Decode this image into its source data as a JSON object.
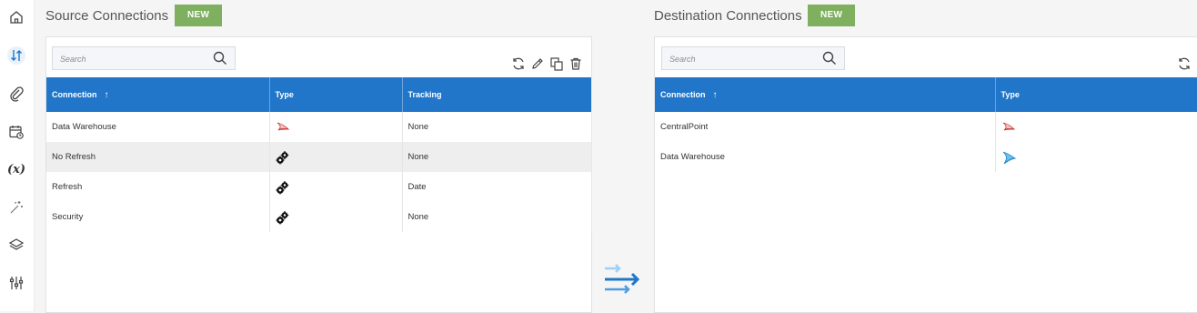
{
  "sidebar": {
    "items": [
      {
        "icon": "home-icon"
      },
      {
        "icon": "transfer-icon",
        "selected": true
      },
      {
        "icon": "paperclip-icon"
      },
      {
        "icon": "calendar-clock-icon"
      },
      {
        "icon": "variable-icon",
        "text": "(x)"
      },
      {
        "icon": "magic-wand-icon"
      },
      {
        "icon": "layers-icon"
      },
      {
        "icon": "sliders-icon"
      }
    ]
  },
  "source": {
    "title": "Source Connections",
    "new_label": "NEW",
    "search_placeholder": "Search",
    "toolbar": [
      "refresh-icon",
      "edit-icon",
      "copy-icon",
      "delete-icon"
    ],
    "columns": [
      "Connection",
      "Type",
      "Tracking"
    ],
    "rows": [
      {
        "connection": "Data Warehouse",
        "type": "sql-server-icon",
        "tracking": "None",
        "highlighted": false
      },
      {
        "connection": "No Refresh",
        "type": "gears-icon",
        "tracking": "None",
        "highlighted": true
      },
      {
        "connection": "Refresh",
        "type": "gears-icon",
        "tracking": "Date",
        "highlighted": false
      },
      {
        "connection": "Security",
        "type": "gears-icon",
        "tracking": "None",
        "highlighted": false
      }
    ]
  },
  "destination": {
    "title": "Destination Connections",
    "new_label": "NEW",
    "search_placeholder": "Search",
    "toolbar": [
      "refresh-icon"
    ],
    "columns": [
      "Connection",
      "Type"
    ],
    "rows": [
      {
        "connection": "CentralPoint",
        "type": "sql-server-icon"
      },
      {
        "connection": "Data Warehouse",
        "type": "azure-sql-icon"
      }
    ]
  },
  "colors": {
    "header": "#2176c9",
    "new_button": "#7eb05f",
    "highlight_row": "#eeeeee",
    "transfer_light": "#9fd0f5",
    "transfer_dark": "#2176c9"
  }
}
